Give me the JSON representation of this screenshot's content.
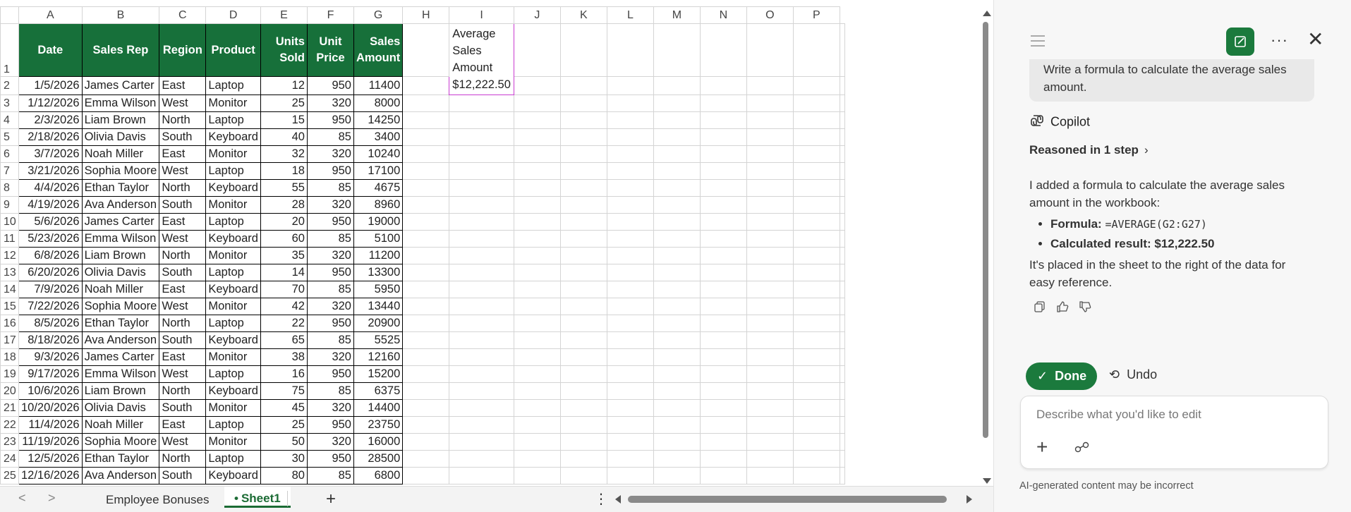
{
  "columns": [
    "A",
    "B",
    "C",
    "D",
    "E",
    "F",
    "G",
    "H",
    "I",
    "J",
    "K",
    "L",
    "M",
    "N",
    "O",
    "P"
  ],
  "headers": [
    "Date",
    "Sales Rep",
    "Region",
    "Product",
    "Units Sold",
    "Unit Price",
    "Sales Amount"
  ],
  "rows": [
    [
      "1/5/2026",
      "James Carter",
      "East",
      "Laptop",
      "12",
      "950",
      "11400"
    ],
    [
      "1/12/2026",
      "Emma Wilson",
      "West",
      "Monitor",
      "25",
      "320",
      "8000"
    ],
    [
      "2/3/2026",
      "Liam Brown",
      "North",
      "Laptop",
      "15",
      "950",
      "14250"
    ],
    [
      "2/18/2026",
      "Olivia Davis",
      "South",
      "Keyboard",
      "40",
      "85",
      "3400"
    ],
    [
      "3/7/2026",
      "Noah Miller",
      "East",
      "Monitor",
      "32",
      "320",
      "10240"
    ],
    [
      "3/21/2026",
      "Sophia Moore",
      "West",
      "Laptop",
      "18",
      "950",
      "17100"
    ],
    [
      "4/4/2026",
      "Ethan Taylor",
      "North",
      "Keyboard",
      "55",
      "85",
      "4675"
    ],
    [
      "4/19/2026",
      "Ava Anderson",
      "South",
      "Monitor",
      "28",
      "320",
      "8960"
    ],
    [
      "5/6/2026",
      "James Carter",
      "East",
      "Laptop",
      "20",
      "950",
      "19000"
    ],
    [
      "5/23/2026",
      "Emma Wilson",
      "West",
      "Keyboard",
      "60",
      "85",
      "5100"
    ],
    [
      "6/8/2026",
      "Liam Brown",
      "North",
      "Monitor",
      "35",
      "320",
      "11200"
    ],
    [
      "6/20/2026",
      "Olivia Davis",
      "South",
      "Laptop",
      "14",
      "950",
      "13300"
    ],
    [
      "7/9/2026",
      "Noah Miller",
      "East",
      "Keyboard",
      "70",
      "85",
      "5950"
    ],
    [
      "7/22/2026",
      "Sophia Moore",
      "West",
      "Monitor",
      "42",
      "320",
      "13440"
    ],
    [
      "8/5/2026",
      "Ethan Taylor",
      "North",
      "Laptop",
      "22",
      "950",
      "20900"
    ],
    [
      "8/18/2026",
      "Ava Anderson",
      "South",
      "Keyboard",
      "65",
      "85",
      "5525"
    ],
    [
      "9/3/2026",
      "James Carter",
      "East",
      "Monitor",
      "38",
      "320",
      "12160"
    ],
    [
      "9/17/2026",
      "Emma Wilson",
      "West",
      "Laptop",
      "16",
      "950",
      "15200"
    ],
    [
      "10/6/2026",
      "Liam Brown",
      "North",
      "Keyboard",
      "75",
      "85",
      "6375"
    ],
    [
      "10/20/2026",
      "Olivia Davis",
      "South",
      "Monitor",
      "45",
      "320",
      "14400"
    ],
    [
      "11/4/2026",
      "Noah Miller",
      "East",
      "Laptop",
      "25",
      "950",
      "23750"
    ],
    [
      "11/19/2026",
      "Sophia Moore",
      "West",
      "Monitor",
      "50",
      "320",
      "16000"
    ],
    [
      "12/5/2026",
      "Ethan Taylor",
      "North",
      "Laptop",
      "30",
      "950",
      "28500"
    ],
    [
      "12/16/2026",
      "Ava Anderson",
      "South",
      "Keyboard",
      "80",
      "85",
      "6800"
    ]
  ],
  "avg_cell": {
    "label": "Average Sales Amount",
    "value": "$12,222.50"
  },
  "tabs": {
    "prev": "<",
    "next": ">",
    "sheet1": "Employee Bonuses",
    "sheet2": "Sheet1",
    "add": "+",
    "more": "⋮"
  },
  "pane": {
    "user_message": "Write a formula to calculate the average sales amount.",
    "assistant_name": "Copilot",
    "reasoned": "Reasoned in 1 step",
    "answer_intro": "I added a formula to calculate the average sales amount in the workbook:",
    "bullet1_label": "Formula:",
    "bullet1_value": "=AVERAGE(G2:G27)",
    "bullet2_label": "Calculated result:",
    "bullet2_value": "$12,222.50",
    "answer_outro": "It's placed in the sheet to the right of the data for easy reference.",
    "done_label": "Done",
    "undo_label": "Undo",
    "input_placeholder": "Describe what you'd like to edit",
    "disclaimer": "AI-generated content may be incorrect"
  },
  "colors": {
    "header_green": "#17703a",
    "accent_green": "#1b7a3d",
    "selection_pink": "#c93bd1"
  }
}
